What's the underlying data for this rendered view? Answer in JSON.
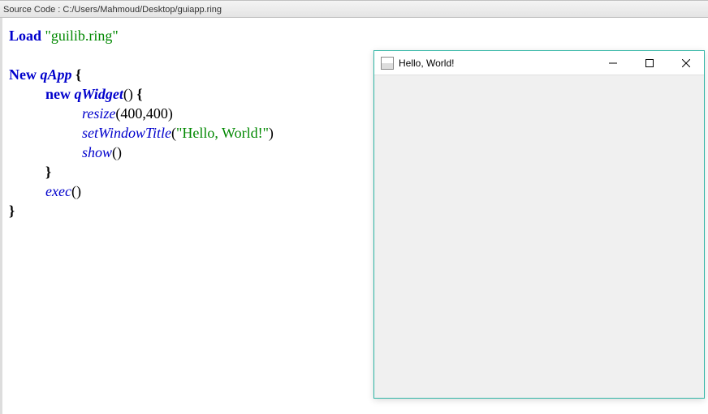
{
  "tab": {
    "label": "Source Code : C:/Users/Mahmoud/Desktop/guiapp.ring"
  },
  "code": {
    "load_kw": "Load",
    "load_str": "\"guilib.ring\"",
    "new_kw": "New",
    "qapp": "qApp",
    "new2_kw": "new",
    "qwidget": "qWidget",
    "resize_m": "resize",
    "resize_args": "(400,400)",
    "setwt_m": "setWindowTitle",
    "setwt_arg_open": "(",
    "setwt_str": "\"Hello, World!\"",
    "setwt_arg_close": ")",
    "show_m": "show",
    "show_args": "()",
    "exec_m": "exec",
    "exec_args": "()",
    "brace_open": "{",
    "brace_close": "}"
  },
  "window": {
    "title": "Hello, World!"
  }
}
